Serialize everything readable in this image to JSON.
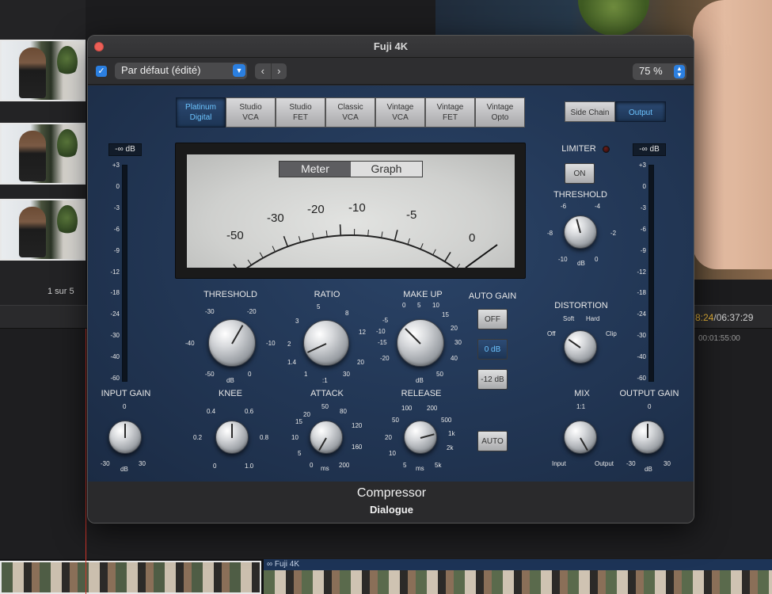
{
  "background": {
    "page_count": "1 sur 5",
    "timecode_current": "8:24",
    "timecode_total": "/06:37:29",
    "timecode_sub": "00:01:55:00",
    "clip_label": "∞ Fuji 4K"
  },
  "window": {
    "title": "Fuji 4K",
    "enabled_check": "✓",
    "preset": "Par défaut (édité)",
    "nav_prev": "‹",
    "nav_next": "›",
    "zoom": "75 %",
    "footer_title": "Compressor",
    "footer_subtitle": "Dialogue"
  },
  "models": [
    {
      "l1": "Platinum",
      "l2": "Digital",
      "active": true
    },
    {
      "l1": "Studio",
      "l2": "VCA"
    },
    {
      "l1": "Studio",
      "l2": "FET"
    },
    {
      "l1": "Classic",
      "l2": "VCA"
    },
    {
      "l1": "Vintage",
      "l2": "VCA"
    },
    {
      "l1": "Vintage",
      "l2": "FET"
    },
    {
      "l1": "Vintage",
      "l2": "Opto"
    }
  ],
  "sidechain": {
    "side_chain": "Side Chain",
    "output": "Output"
  },
  "meter": {
    "tab_meter": "Meter",
    "tab_graph": "Graph",
    "scale": [
      "-50",
      "-30",
      "-20",
      "-10",
      "-5",
      "0"
    ]
  },
  "input_meter": {
    "readout": "-∞ dB",
    "scale": [
      "+3",
      "0",
      "-3",
      "-6",
      "-9",
      "-12",
      "-18",
      "-24",
      "-30",
      "-40",
      "-60"
    ]
  },
  "output_meter": {
    "readout": "-∞ dB",
    "scale": [
      "+3",
      "0",
      "-3",
      "-6",
      "-9",
      "-12",
      "-18",
      "-24",
      "-30",
      "-40",
      "-60"
    ]
  },
  "controls": {
    "threshold": {
      "label": "THRESHOLD",
      "ticks": [
        "-30",
        "-20",
        "-40",
        "-10",
        "-50",
        "0"
      ],
      "unit": "dB"
    },
    "ratio": {
      "label": "RATIO",
      "ticks": [
        "5",
        "3",
        "8",
        "12",
        "2",
        "1.4",
        "20",
        "1",
        "30"
      ],
      "unit": ":1"
    },
    "makeup": {
      "label": "MAKE UP",
      "ticks": [
        "0",
        "5",
        "10",
        "-5",
        "15",
        "-10",
        "20",
        "-15",
        "30",
        "-20",
        "40",
        "50"
      ],
      "unit": "dB"
    },
    "auto_gain": {
      "label": "AUTO GAIN",
      "off": "OFF",
      "zero": "0 dB",
      "minus12": "-12 dB"
    },
    "knee": {
      "label": "KNEE",
      "ticks": [
        "0.4",
        "0.6",
        "0.2",
        "0.8",
        "0",
        "1.0"
      ]
    },
    "attack": {
      "label": "ATTACK",
      "ticks": [
        "20",
        "50",
        "15",
        "80",
        "10",
        "120",
        "5",
        "160",
        "0",
        "200"
      ],
      "unit": "ms"
    },
    "release": {
      "label": "RELEASE",
      "ticks": [
        "100",
        "200",
        "50",
        "500",
        "20",
        "1k",
        "10",
        "2k",
        "5",
        "5k"
      ],
      "unit": "ms"
    },
    "auto": "AUTO",
    "input_gain": {
      "label": "INPUT GAIN",
      "ticks": [
        "0",
        "-30",
        "30"
      ],
      "unit": "dB"
    },
    "limiter": {
      "label": "LIMITER",
      "on": "ON"
    },
    "lim_threshold": {
      "label": "THRESHOLD",
      "ticks": [
        "-6",
        "-4",
        "-8",
        "-2",
        "-10",
        "0"
      ],
      "unit": "dB"
    },
    "distortion": {
      "label": "DISTORTION",
      "soft": "Soft",
      "hard": "Hard",
      "off": "Off",
      "clip": "Clip"
    },
    "mix": {
      "label": "MIX",
      "top": "1:1",
      "left": "Input",
      "right": "Output"
    },
    "output_gain": {
      "label": "OUTPUT GAIN",
      "ticks": [
        "0",
        "-30",
        "30"
      ],
      "unit": "dB"
    }
  }
}
